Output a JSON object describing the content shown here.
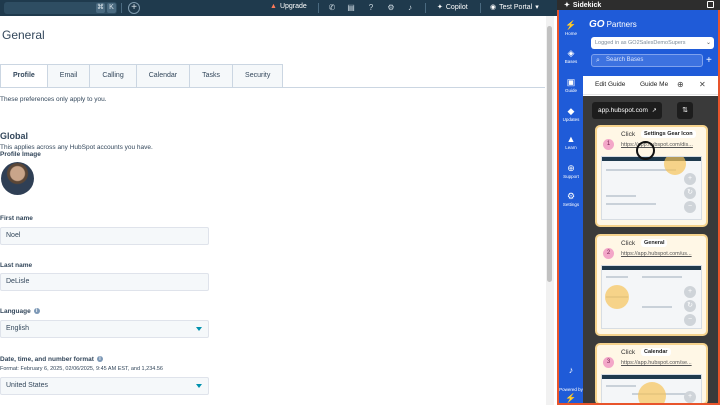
{
  "topbar": {
    "search_keys": [
      "⌘",
      "K"
    ],
    "upgrade_label": "Upgrade",
    "copilot_label": "Copilot",
    "portal_label": "Test Portal"
  },
  "page": {
    "title": "General",
    "tabs": [
      {
        "label": "Profile",
        "active": true
      },
      {
        "label": "Email",
        "active": false
      },
      {
        "label": "Calling",
        "active": false
      },
      {
        "label": "Calendar",
        "active": false
      },
      {
        "label": "Tasks",
        "active": false
      },
      {
        "label": "Security",
        "active": false
      }
    ],
    "prefs_note": "These preferences only apply to you.",
    "global_heading": "Global",
    "global_sub": "This applies across any HubSpot accounts you have.",
    "profile_image_label": "Profile Image",
    "first_name_label": "First name",
    "first_name_value": "Noel",
    "last_name_label": "Last name",
    "last_name_value": "DeLisle",
    "language_label": "Language",
    "language_value": "English",
    "datetime_label": "Date, time, and number format",
    "datetime_format": "Format: February 6, 2025, 02/06/2025, 9:45 AM EST, and 1,234.56",
    "region_value": "United States"
  },
  "sidekick": {
    "title": "Sidekick",
    "brand_go": "GO",
    "brand_partners": "Partners",
    "logged_in": "Logged in as GO2SalesDemoSupers",
    "search_placeholder": "Search Bases",
    "rail": [
      {
        "icon": "home-icon",
        "label": "Home"
      },
      {
        "icon": "bases-icon",
        "label": "Bases"
      },
      {
        "icon": "guide-icon",
        "label": "Guide"
      },
      {
        "icon": "updates-icon",
        "label": "Updates"
      },
      {
        "icon": "learn-icon",
        "label": "Learn"
      },
      {
        "icon": "support-icon",
        "label": "Support"
      },
      {
        "icon": "settings-icon",
        "label": "Settings"
      }
    ],
    "powered_by": "Powered by",
    "edit_guide": "Edit Guide",
    "guide_me": "Guide Me",
    "url_pill": "app.hubspot.com",
    "steps": [
      {
        "num": "1",
        "action": "Click",
        "target": "Settings Gear Icon",
        "url": "https://app.hubspot.com/dis..."
      },
      {
        "num": "2",
        "action": "Click",
        "target": "General",
        "url": "https://app.hubspot.com/us..."
      },
      {
        "num": "3",
        "action": "Click",
        "target": "Calendar",
        "url": "https://app.hubspot.com/se..."
      }
    ]
  },
  "colors": {
    "topbar": "#1f3a4d",
    "sidekick_blue": "#1f5bd8",
    "highlight_border": "#e8542b",
    "step_badge": "#f3a6c8"
  }
}
